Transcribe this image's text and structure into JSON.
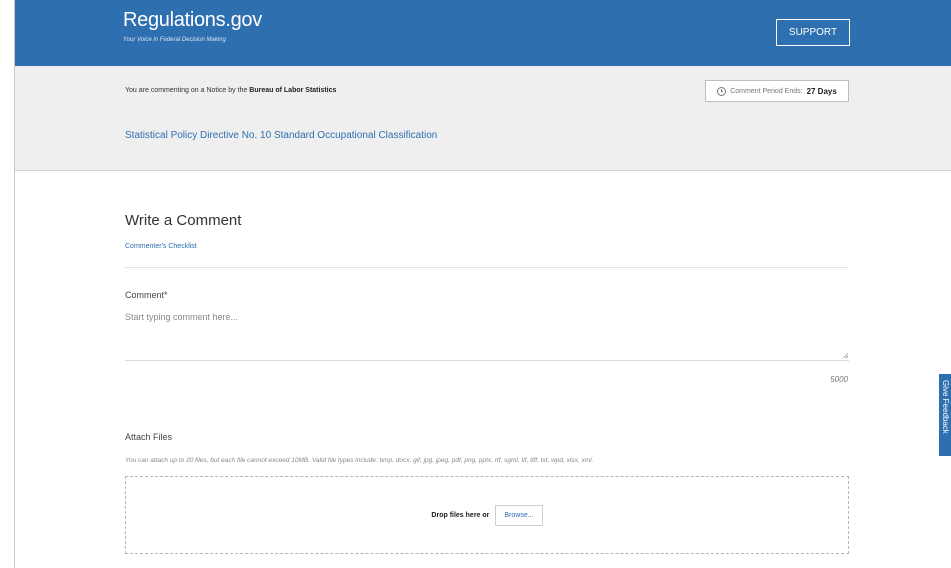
{
  "header": {
    "logo_title": "Regulations.gov",
    "logo_tagline": "Your Voice in Federal Decision Making",
    "support_label": "SUPPORT",
    "brand_color": "#2e6fb0"
  },
  "notice": {
    "prefix": "You are commenting on a Notice by the",
    "agency": "Bureau of Labor Statistics",
    "period_label": "Comment Period Ends:",
    "period_days": "27 Days",
    "document_title": "Statistical Policy Directive No. 10 Standard Occupational Classification"
  },
  "comment_form": {
    "title": "Write a Comment",
    "checklist_link": "Commenter's Checklist",
    "comment_label": "Comment*",
    "comment_placeholder": "Start typing comment here...",
    "char_count": "5000"
  },
  "attachments": {
    "label": "Attach Files",
    "help": "You can attach up to 20 files, but each file cannot exceed 10MB. Valid file types include: bmp, docx, gif, jpg, jpeg, pdf, png, pptx, rtf, sgml, tif, tiff, txt, wpd, xlsx, xml.",
    "drop_text": "Drop files here or",
    "browse_label": "Browse..."
  },
  "feedback": {
    "label": "Give Feedback"
  }
}
